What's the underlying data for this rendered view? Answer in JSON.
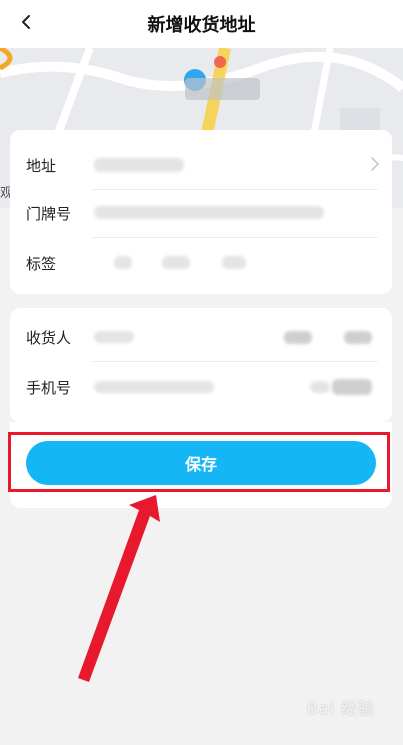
{
  "header": {
    "title": "新增收货地址"
  },
  "address_card": {
    "address_label": "地址",
    "door_number_label": "门牌号",
    "tag_label": "标签"
  },
  "contact_card": {
    "receiver_label": "收货人",
    "phone_label": "手机号"
  },
  "save_button": {
    "label": "保存"
  },
  "map": {
    "partial_text": "观"
  },
  "annotation": {
    "highlight_color": "#e8192c"
  },
  "watermark": {
    "text": "Bai 经验"
  },
  "colors": {
    "accent": "#14b6f5",
    "annotation_red": "#e8192c"
  }
}
